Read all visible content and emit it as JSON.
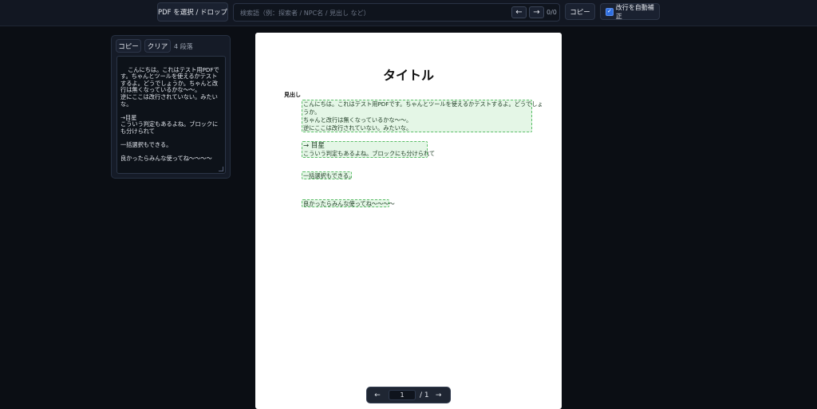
{
  "toolbar": {
    "select_pdf_label": "PDF を選択 / ドロップ",
    "search_placeholder": "検索語（例：探索者 / NPC名 / 見出し など）",
    "prev_match": "←",
    "next_match": "→",
    "match_count": "0/0",
    "copy_label": "コピー",
    "auto_linebreak_label": "改行を自動補正",
    "auto_linebreak_checked": true
  },
  "side_panel": {
    "copy_label": "コピー",
    "clear_label": "クリア",
    "paragraph_count": "4 段落",
    "text": "こんにちは。これはテスト用PDFです。ちゃんとツールを使えるかテストするよ。どうでしょうか。ちゃんと改行は無くなっているかな～～。\n逆にここは改行されていない。みたいな。\n\n→目星\nこういう判定もあるよね。ブロックにも分けられて\n\n一括選択もできる。\n\n良かったらみんな使ってね～～～～"
  },
  "pdf_page": {
    "title": "タイトル",
    "heading": "見出し",
    "blocks": [
      {
        "lines": [
          "こんにちは。これはテスト用PDFです。ちゃんとツールを使えるかテストするよ。どうでしょ",
          "うか。",
          "ちゃんと改行は無くなっているかな～～。",
          "逆にここは改行されていない。みたいな。"
        ]
      },
      {
        "lines": [
          "→ 目星",
          "こういう判定もあるよね。ブロックにも分けられて"
        ]
      },
      {
        "lines": [
          "一括選択もできる。"
        ]
      },
      {
        "lines": [
          "良かったらみんな使ってね～～～～"
        ]
      }
    ]
  },
  "pager": {
    "prev": "←",
    "current_page": "1",
    "total": "/ 1",
    "next": "→"
  },
  "colors": {
    "background": "#0b0e14",
    "highlight_fill": "#e4f6e6",
    "highlight_border": "#5cbf69",
    "checkbox_accent": "#2f6fe0"
  }
}
